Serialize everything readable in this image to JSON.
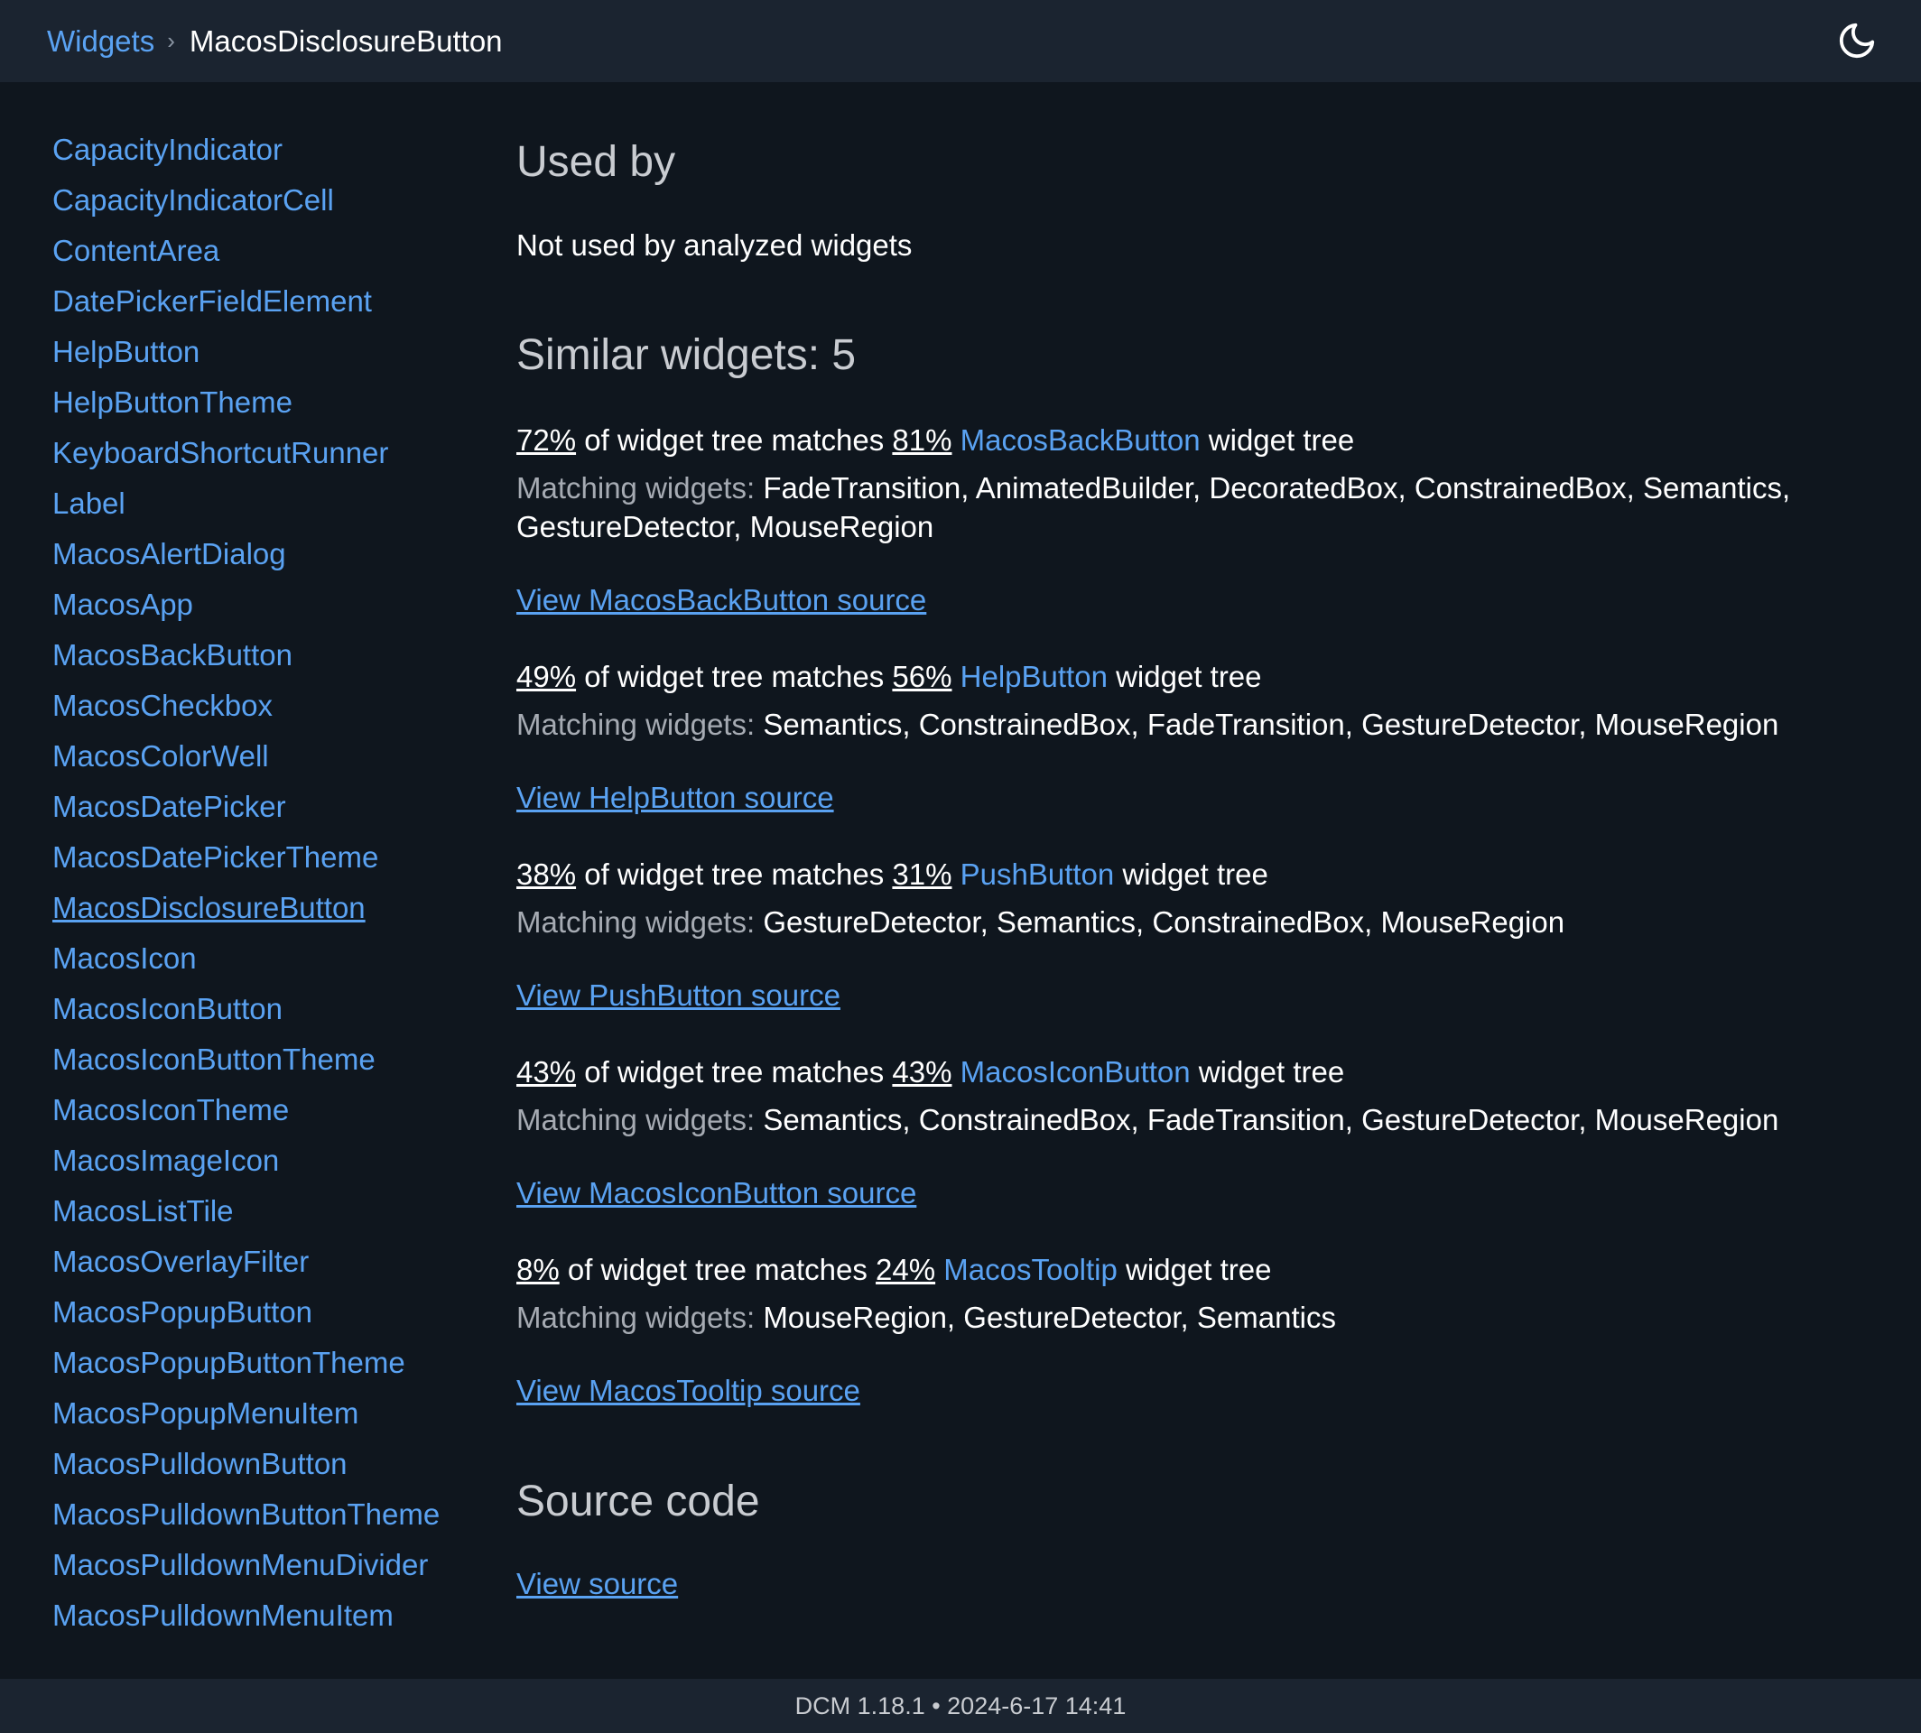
{
  "breadcrumb": {
    "root": "Widgets",
    "separator": "›",
    "current": "MacosDisclosureButton"
  },
  "theme_toggle_icon": "moon-icon",
  "sidebar": {
    "items": [
      "CapacityIndicator",
      "CapacityIndicatorCell",
      "ContentArea",
      "DatePickerFieldElement",
      "HelpButton",
      "HelpButtonTheme",
      "KeyboardShortcutRunner",
      "Label",
      "MacosAlertDialog",
      "MacosApp",
      "MacosBackButton",
      "MacosCheckbox",
      "MacosColorWell",
      "MacosDatePicker",
      "MacosDatePickerTheme",
      "MacosDisclosureButton",
      "MacosIcon",
      "MacosIconButton",
      "MacosIconButtonTheme",
      "MacosIconTheme",
      "MacosImageIcon",
      "MacosListTile",
      "MacosOverlayFilter",
      "MacosPopupButton",
      "MacosPopupButtonTheme",
      "MacosPopupMenuItem",
      "MacosPulldownButton",
      "MacosPulldownButtonTheme",
      "MacosPulldownMenuDivider",
      "MacosPulldownMenuItem"
    ],
    "active": "MacosDisclosureButton"
  },
  "used_by": {
    "heading": "Used by",
    "text": "Not used by analyzed widgets"
  },
  "similar": {
    "heading": "Similar widgets: 5",
    "of_text": " of widget tree matches ",
    "tree_text": " widget tree",
    "matching_label": "Matching widgets:",
    "items": [
      {
        "pct": "72%",
        "other_pct": "81%",
        "name": "MacosBackButton",
        "matching_line1": "FadeTransition, AnimatedBuilder, DecoratedBox, ConstrainedBox, Semantics,",
        "matching_line2": "GestureDetector, MouseRegion",
        "link": "View MacosBackButton source"
      },
      {
        "pct": "49%",
        "other_pct": "56%",
        "name": "HelpButton",
        "matching_line1": "Semantics, ConstrainedBox, FadeTransition, GestureDetector, MouseRegion",
        "matching_line2": "",
        "link": "View HelpButton source"
      },
      {
        "pct": "38%",
        "other_pct": "31%",
        "name": "PushButton",
        "matching_line1": "GestureDetector, Semantics, ConstrainedBox, MouseRegion",
        "matching_line2": "",
        "link": "View PushButton source"
      },
      {
        "pct": "43%",
        "other_pct": "43%",
        "name": "MacosIconButton",
        "matching_line1": "Semantics, ConstrainedBox, FadeTransition, GestureDetector, MouseRegion",
        "matching_line2": "",
        "link": "View MacosIconButton source"
      },
      {
        "pct": "8%",
        "other_pct": "24%",
        "name": "MacosTooltip",
        "matching_line1": "MouseRegion, GestureDetector, Semantics",
        "matching_line2": "",
        "link": "View MacosTooltip source"
      }
    ]
  },
  "source_code": {
    "heading": "Source code",
    "link": "View source"
  },
  "footer": {
    "text": "DCM 1.18.1 • 2024-6-17 14:41"
  }
}
